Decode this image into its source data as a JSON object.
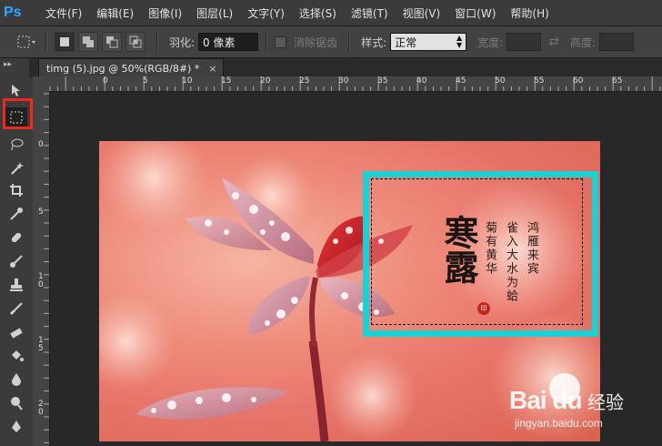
{
  "app": {
    "logo": "Ps"
  },
  "menu": {
    "items": [
      {
        "label": "文件(F)"
      },
      {
        "label": "编辑(E)"
      },
      {
        "label": "图像(I)"
      },
      {
        "label": "图层(L)"
      },
      {
        "label": "文字(Y)"
      },
      {
        "label": "选择(S)"
      },
      {
        "label": "滤镜(T)"
      },
      {
        "label": "视图(V)"
      },
      {
        "label": "窗口(W)"
      },
      {
        "label": "帮助(H)"
      }
    ]
  },
  "options": {
    "feather_label": "羽化:",
    "feather_value": "0 像素",
    "antialias_label": "消除锯齿",
    "style_label": "样式:",
    "style_value": "正常",
    "width_label": "宽度:",
    "height_label": "高度:"
  },
  "document": {
    "tab_title": "timg (5).jpg @ 50%(RGB/8#) *",
    "close_glyph": "×"
  },
  "rulers": {
    "h_ticks": [
      "0",
      "5",
      "10",
      "15",
      "20",
      "25",
      "30",
      "35",
      "40",
      "45",
      "50",
      "55",
      "60",
      "65"
    ],
    "v_ticks": [
      "0",
      "5",
      "1\n0",
      "1\n5",
      "2\n0"
    ]
  },
  "poem": {
    "title": "寒露",
    "line1": "鸿雁来宾",
    "line2": "雀入大水为蛤",
    "line3": "菊有黄华",
    "seal_text": "印"
  },
  "watermark": {
    "logo": "Bai du",
    "brand": "经验",
    "url": "jingyan.baidu.com"
  },
  "colors": {
    "highlight_red": "#f0291f",
    "highlight_cyan": "#1bd1d3",
    "ps_blue": "#31a8ff"
  }
}
